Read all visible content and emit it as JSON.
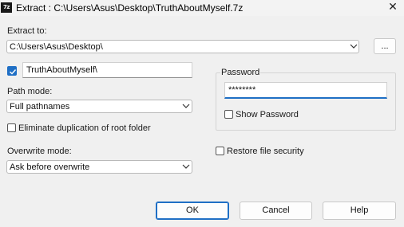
{
  "window": {
    "title": "Extract : C:\\Users\\Asus\\Desktop\\TruthAboutMyself.7z",
    "app_icon_text": "7z",
    "close_glyph": "✕"
  },
  "extract_to": {
    "label": "Extract to:",
    "value": "C:\\Users\\Asus\\Desktop\\",
    "browse_label": "..."
  },
  "subfolder": {
    "checked": true,
    "value": "TruthAboutMyself\\"
  },
  "path_mode": {
    "label": "Path mode:",
    "value": "Full pathnames"
  },
  "eliminate_duplication": {
    "label": "Eliminate duplication of root folder",
    "checked": false
  },
  "overwrite_mode": {
    "label": "Overwrite mode:",
    "value": "Ask before overwrite"
  },
  "password": {
    "group_label": "Password",
    "value": "********",
    "show_label": "Show Password",
    "show_checked": false
  },
  "restore_security": {
    "label": "Restore file security",
    "checked": false
  },
  "buttons": {
    "ok": "OK",
    "cancel": "Cancel",
    "help": "Help"
  },
  "colors": {
    "accent": "#1f6fc5",
    "background": "#f0f0f0"
  }
}
